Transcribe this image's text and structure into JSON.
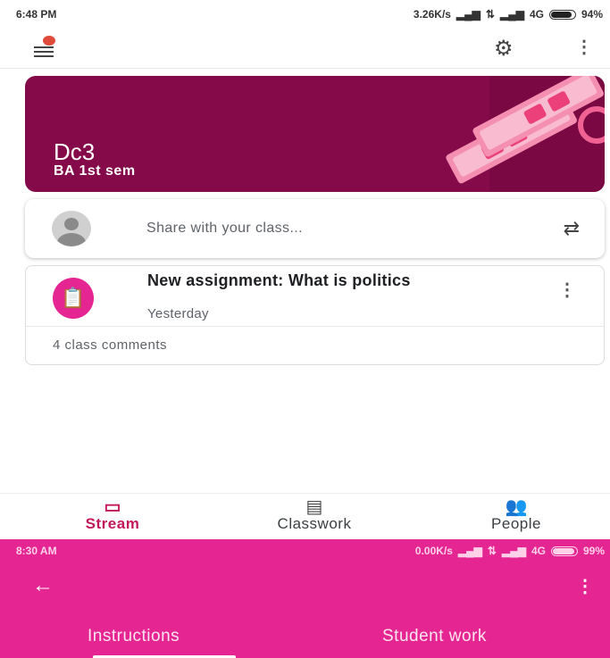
{
  "status_bar": {
    "time": "6:48 PM",
    "network_speed": "3.26K/s",
    "network_type": "4G",
    "battery": "94%",
    "battery_level": 0.94
  },
  "app_bar": {
    "menu_icon": "hamburger-icon",
    "settings_icon": "gear-icon",
    "more_icon": "kebab-icon"
  },
  "class_banner": {
    "title": "Dc3",
    "subtitle": "BA 1st sem",
    "color": "#840a4a"
  },
  "share_box": {
    "placeholder": "Share with your class...",
    "repost_icon": "repost-icon"
  },
  "stream_item": {
    "title": "New assignment: What is politics",
    "date": "Yesterday",
    "comments": "4 class comments",
    "icon": "assignment-icon",
    "accent": "#e52592"
  },
  "bottom_nav": {
    "tabs": [
      {
        "label": "Stream",
        "icon": "stream-icon",
        "active": true
      },
      {
        "label": "Classwork",
        "icon": "classwork-icon",
        "active": false
      },
      {
        "label": "People",
        "icon": "people-icon",
        "active": false
      }
    ]
  },
  "second_screen": {
    "status_bar": {
      "time": "8:30 AM",
      "network_speed": "0.00K/s",
      "network_type": "4G",
      "battery": "99%",
      "battery_level": 0.99
    },
    "back_icon": "arrow-back-icon",
    "more_icon": "kebab-icon",
    "tabs": [
      "Instructions",
      "Student work"
    ],
    "color": "#e52592"
  }
}
